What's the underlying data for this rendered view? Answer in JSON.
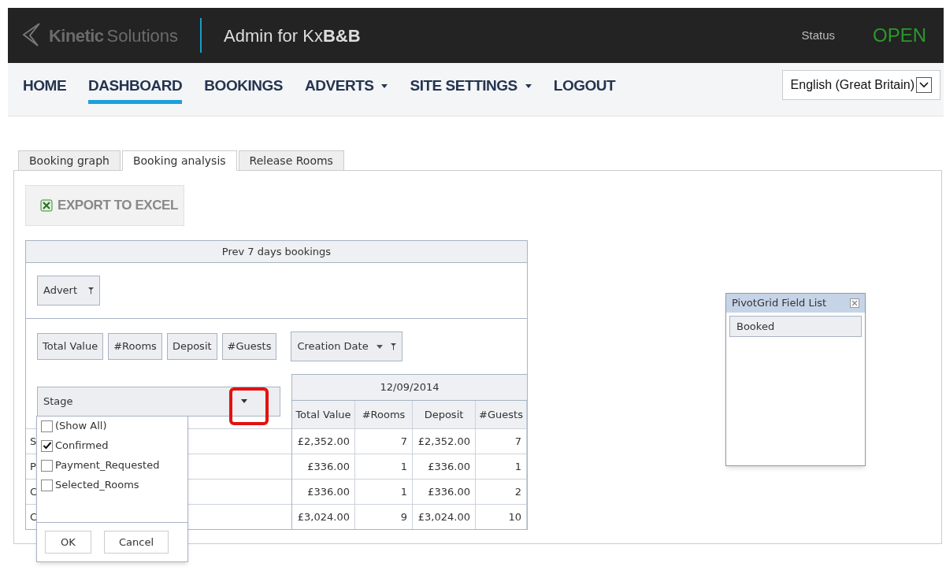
{
  "header": {
    "brand_bold": "Kinetic",
    "brand_light": "Solutions",
    "title": "Admin for Kx**B&B**",
    "status_label": "Status",
    "status_value": "OPEN"
  },
  "nav": [
    {
      "label": "HOME",
      "selected": false,
      "dropdown": false
    },
    {
      "label": "DASHBOARD",
      "selected": true,
      "dropdown": false
    },
    {
      "label": "BOOKINGS",
      "selected": false,
      "dropdown": false
    },
    {
      "label": "ADVERTS",
      "selected": false,
      "dropdown": true
    },
    {
      "label": "SITE SETTINGS",
      "selected": false,
      "dropdown": true
    },
    {
      "label": "LOGOUT",
      "selected": false,
      "dropdown": false
    }
  ],
  "language": {
    "value": "English (Great Britain)"
  },
  "tabs": [
    {
      "label": "Booking graph",
      "selected": false
    },
    {
      "label": "Booking analysis",
      "selected": true
    },
    {
      "label": "Release Rooms",
      "selected": false
    }
  ],
  "export_button": "EXPORT TO EXCEL",
  "pivot": {
    "title": "Prev 7 days bookings",
    "filter_fields": [
      "Advert"
    ],
    "data_fields": [
      "Total Value",
      "#Rooms",
      "Deposit",
      "#Guests"
    ],
    "column_field": "Creation Date",
    "row_field": "Stage",
    "date": "12/09/2014",
    "columns": [
      "Total Value",
      "#Rooms",
      "Deposit",
      "#Guests"
    ],
    "rows": [
      {
        "label": "S",
        "cells": [
          "£2,352.00",
          "7",
          "£2,352.00",
          "7"
        ]
      },
      {
        "label": "P",
        "cells": [
          "£336.00",
          "1",
          "£336.00",
          "1"
        ]
      },
      {
        "label": "C",
        "cells": [
          "£336.00",
          "1",
          "£336.00",
          "2"
        ]
      },
      {
        "label": "C",
        "cells": [
          "£3,024.00",
          "9",
          "£3,024.00",
          "10"
        ]
      }
    ]
  },
  "filter_popup": {
    "options": [
      {
        "label": "(Show All)",
        "checked": false
      },
      {
        "label": "Confirmed",
        "checked": true
      },
      {
        "label": "Payment_Requested",
        "checked": false
      },
      {
        "label": "Selected_Rooms",
        "checked": false
      }
    ],
    "buttons": [
      "OK",
      "Cancel"
    ]
  },
  "field_list": {
    "title": "PivotGrid Field List",
    "items": [
      "Booked"
    ]
  }
}
